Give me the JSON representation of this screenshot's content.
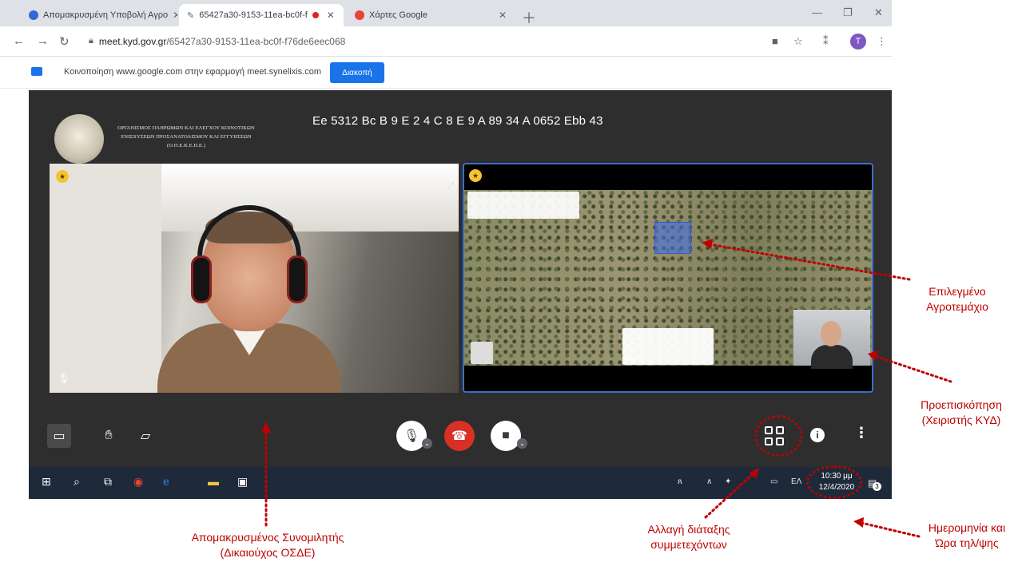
{
  "browser": {
    "tabs": [
      {
        "title": "Απομακρυσμένη Υποβολή Αγρο",
        "favicon_color": "#3367d6"
      },
      {
        "title": "65427a30-9153-11ea-bc0f-f",
        "favicon_color": "#5f6368"
      },
      {
        "title": "Χάρτες Google",
        "favicon_color": "#ea4335"
      }
    ],
    "url_domain": "meet.kyd.gov.gr",
    "url_path": "/65427a30-9153-11ea-bc0f-f76de6eec068",
    "profile_initial": "T",
    "infobar_message": "Κοινοποίηση www.google.com στην εφαρμογή meet.synelixis.com",
    "infobar_stop_label": "Διακοπή"
  },
  "meeting": {
    "org_name_line1": "ΟΡΓΑΝΙΣΜΟΣ ΠΛΗΡΩΜΩΝ ΚΑΙ ΕΛΕΓΧΟΥ ΚΟΙΝΟΤΙΚΩΝ",
    "org_name_line2": "ΕΝΙΣΧΥΣΕΩΝ ΠΡΟΣΑΝΑΤΟΛΙΣΜΟΥ ΚΑΙ ΕΓΓΥΗΣΕΩΝ",
    "org_name_line3": "(Ο.Π.Ε.Κ.Ε.Π.Ε.)",
    "title": "Ee 5312 Bc B 9 E 2 4 C 8 E 9 A 89 34 A 0652 Ebb 43"
  },
  "taskbar": {
    "clock_time": "10:30 μμ",
    "clock_date": "12/4/2020",
    "language": "ΕΛ",
    "notification_count": "3"
  },
  "annotations": {
    "selected_parcel": [
      "Επιλεγμένο",
      "Αγροτεμάχιο"
    ],
    "preview": [
      "Προεπισκόπηση",
      "(Χειριστής ΚΥΔ)"
    ],
    "date_time": [
      "Ημερομηνία και",
      "Ώρα τηλ/ψης"
    ],
    "layout_change": [
      "Αλλαγή διάταξης",
      "συμμετεχόντων"
    ],
    "remote_speaker": [
      "Απομακρυσμένος Συνομιλητής",
      "(Δικαιούχος ΟΣΔΕ)"
    ]
  },
  "colors": {
    "annotation_red": "#c00000",
    "tile_highlight": "#3b6ecb",
    "hangup_red": "#d93025",
    "meeting_bg": "#2e2e2e"
  }
}
